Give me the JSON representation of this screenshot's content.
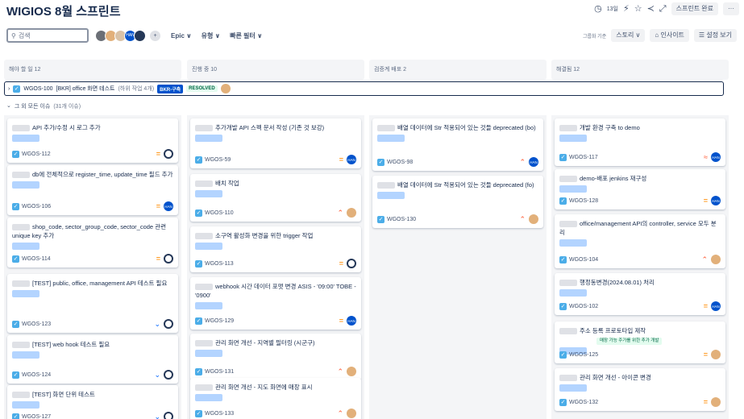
{
  "header": {
    "title": "WIGIOS 8월 스프린트",
    "time_left": "13일",
    "complete_button": "스프린트 완료",
    "more": "···"
  },
  "toolbar": {
    "search_placeholder": "검색",
    "avatar_han": "HAN",
    "filters": [
      "Epic ∨",
      "유형 ∨",
      "빠른 필터 ∨"
    ],
    "group_by_label": "그룹화 기준",
    "group_by_value": "스토리 ∨",
    "insights": "인사이트",
    "view_settings": "설정 보기"
  },
  "columns": [
    {
      "title": "해야 할 일 12"
    },
    {
      "title": "진행 중 10"
    },
    {
      "title": "검증계 배포 2"
    },
    {
      "title": "해결됨 12"
    }
  ],
  "parent": {
    "key": "WGOS-100",
    "summary": "[BKR] office 화면 테스트",
    "subtasks": "(하위 작업 4개)",
    "epic": "BKR-구축",
    "status": "RESOLVED"
  },
  "other_issues": {
    "label": "그 외 모든 이슈",
    "count": "(31개 이슈)"
  },
  "cards": {
    "c0": [
      {
        "text": "API 추가/수정 시 로그 추가",
        "key": "WGOS-112",
        "priority": "=",
        "assignee": "ghost"
      },
      {
        "text": "db에 전체적으로 register_time, update_time 필드 추가",
        "key": "WGOS-106",
        "priority": "=",
        "assignee": "HAN"
      },
      {
        "text": "shop_code, sector_group_code, sector_code 관련 unique key 추가",
        "key": "WGOS-114",
        "priority": "=",
        "assignee": "ghost"
      },
      {
        "text": "[TEST] public, office, management API 테스트 필요",
        "key": "WGOS-123",
        "priority": "⌄",
        "assignee": "ghost"
      },
      {
        "text": "[TEST] web hook 테스트 필요",
        "key": "WGOS-124",
        "priority": "⌄",
        "assignee": "ghost"
      },
      {
        "text": "[TEST] 화면 단위 테스트",
        "key": "WGOS-127",
        "priority": "⌄",
        "assignee": "ghost"
      }
    ],
    "c1": [
      {
        "text": "추가개발 API 스펙 문서 작성 (기존 것 보강)",
        "key": "WGOS-59",
        "priority": "=",
        "assignee": "HAN"
      },
      {
        "text": "배치 작업",
        "key": "WGOS-110",
        "priority": "^",
        "assignee": "face"
      },
      {
        "text": "소구역 활성화 변경을 위한 trigger 작업",
        "key": "WGOS-113",
        "priority": "=",
        "assignee": "ghost"
      },
      {
        "text": "webhook 시간 데이터 포맷 변경 ASIS - '09:00' TOBE - '0900'",
        "key": "WGOS-129",
        "priority": "=",
        "assignee": "HAN"
      },
      {
        "text": "관리 화면 개선 - 지역별 필터링 (시군구)",
        "key": "WGOS-131",
        "priority": "^",
        "assignee": "face"
      },
      {
        "text": "관리 화면 개선 - 지도 화면에 매장 표시",
        "key": "WGOS-133",
        "priority": "^",
        "assignee": "face"
      }
    ],
    "c2": [
      {
        "text": "배열 데이터에 Str 적용되어 있는 것들 deprecated (bo)",
        "key": "WGOS-98",
        "priority": "^",
        "assignee": "HAN"
      },
      {
        "text": "배열 데이터에 Str 적용되어 있는 것들 deprecated (fo)",
        "key": "WGOS-130",
        "priority": "^",
        "assignee": "face"
      }
    ],
    "c3": [
      {
        "text": "개발 환경 구축 to demo",
        "key": "WGOS-117",
        "priority": "^^",
        "assignee": "HAN"
      },
      {
        "text": "demo-배포 jenkins 재구성",
        "key": "WGOS-128",
        "priority": "=",
        "assignee": "HAN"
      },
      {
        "text": "office/management API의 controller, service 모두 분리",
        "key": "WGOS-104",
        "priority": "^",
        "assignee": "face"
      },
      {
        "text": "행정동변경(2024.08.01) 처리",
        "key": "WGOS-102",
        "priority": "=",
        "assignee": "HAN"
      },
      {
        "text": "주소 등록 프로토타입 제작",
        "tag": "매장 가능 주가를 위한 추가 개발",
        "key": "WGOS-125",
        "priority": "=",
        "assignee": "face"
      },
      {
        "text": "관리 화면 개선 - 아이콘 변경",
        "key": "WGOS-132",
        "priority": "=",
        "assignee": "face"
      }
    ]
  },
  "colors": {
    "accent": "#0052cc",
    "column_bg": "#f4f5f7",
    "epic": "#b3d4ff"
  }
}
